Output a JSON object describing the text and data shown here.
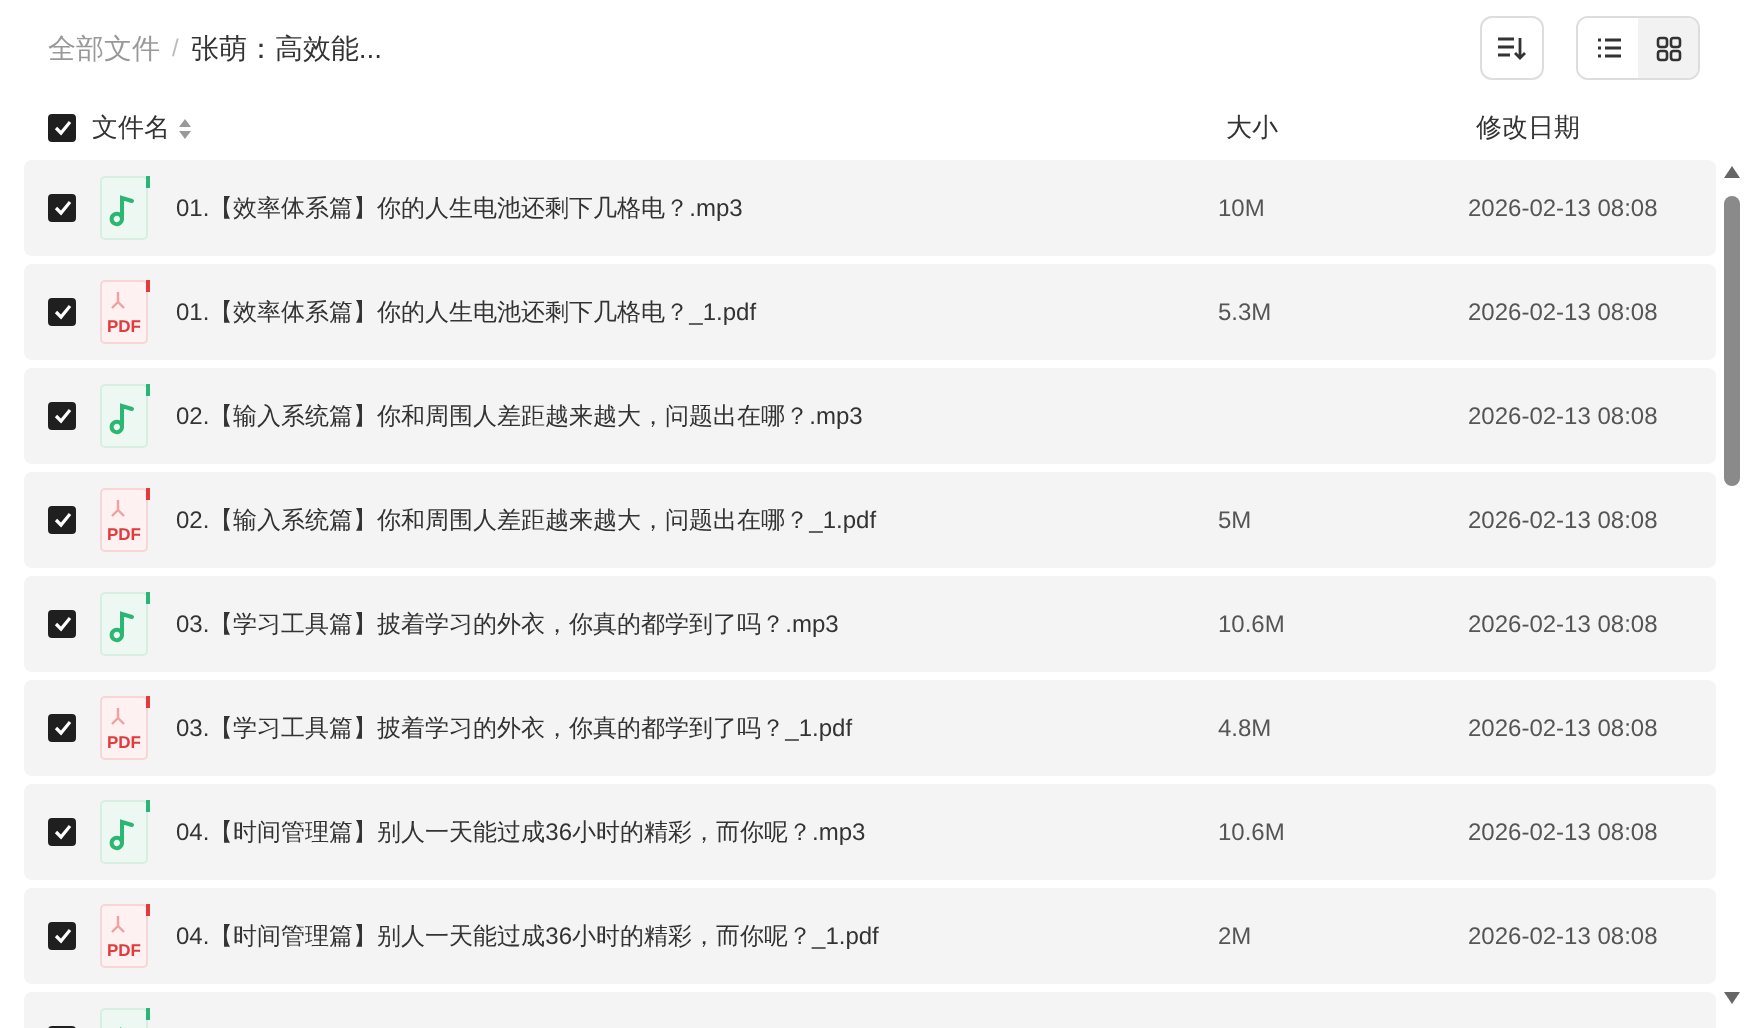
{
  "breadcrumb_separator": "/",
  "breadcrumb": [
    {
      "label": "全部文件",
      "current": false
    },
    {
      "label": "张萌：高效能...",
      "current": true
    }
  ],
  "view_modes": [
    {
      "kind": "list",
      "selected": true
    },
    {
      "kind": "grid",
      "selected": false
    }
  ],
  "header": {
    "checked": true,
    "name": "文件名",
    "size": "大小",
    "date": "修改日期"
  },
  "rows": [
    {
      "kind": "audio",
      "checked": true,
      "name": "01.【效率体系篇】你的人生电池还剩下几格电？.mp3",
      "size": "10M",
      "date": "2026-02-13 08:08"
    },
    {
      "kind": "pdf",
      "icon_label": "PDF",
      "checked": true,
      "name": "01.【效率体系篇】你的人生电池还剩下几格电？_1.pdf",
      "size": "5.3M",
      "date": "2026-02-13 08:08"
    },
    {
      "kind": "audio",
      "checked": true,
      "name": "02.【输入系统篇】你和周围人差距越来越大，问题出在哪？.mp3",
      "date": "2026-02-13 08:08"
    },
    {
      "kind": "pdf",
      "icon_label": "PDF",
      "checked": true,
      "name": "02.【输入系统篇】你和周围人差距越来越大，问题出在哪？_1.pdf",
      "size": "5M",
      "date": "2026-02-13 08:08"
    },
    {
      "kind": "audio",
      "checked": true,
      "name": "03.【学习工具篇】披着学习的外衣，你真的都学到了吗？.mp3",
      "size": "10.6M",
      "date": "2026-02-13 08:08"
    },
    {
      "kind": "pdf",
      "icon_label": "PDF",
      "checked": true,
      "name": "03.【学习工具篇】披着学习的外衣，你真的都学到了吗？_1.pdf",
      "size": "4.8M",
      "date": "2026-02-13 08:08"
    },
    {
      "kind": "audio",
      "checked": true,
      "name": "04.【时间管理篇】别人一天能过成36小时的精彩，而你呢？.mp3",
      "size": "10.6M",
      "date": "2026-02-13 08:08"
    },
    {
      "kind": "pdf",
      "icon_label": "PDF",
      "checked": true,
      "name": "04.【时间管理篇】别人一天能过成36小时的精彩，而你呢？_1.pdf",
      "size": "2M",
      "date": "2026-02-13 08:08"
    },
    {
      "kind": "audio",
      "checked": true
    }
  ]
}
